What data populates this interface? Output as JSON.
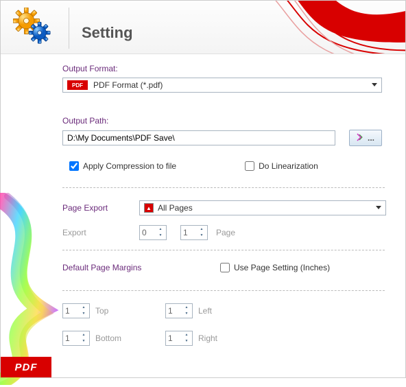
{
  "header": {
    "title": "Setting"
  },
  "output_format": {
    "label": "Output Format:",
    "chip": "PDF",
    "selected": "PDF Format (*.pdf)"
  },
  "output_path": {
    "label": "Output Path:",
    "value": "D:\\My Documents\\PDF Save\\",
    "browse": "..."
  },
  "checks": {
    "compression_label": "Apply Compression to file",
    "compression_checked": true,
    "linearization_label": "Do Linearization",
    "linearization_checked": false
  },
  "page_export": {
    "label": "Page Export",
    "chip": "▲",
    "selected": "All Pages"
  },
  "export_range": {
    "label": "Export",
    "from": "0",
    "to": "1",
    "suffix": "Page"
  },
  "margins": {
    "label": "Default Page Margins",
    "use_page_setting_label": "Use Page Setting (Inches)",
    "use_page_setting_checked": false,
    "top": {
      "value": "1",
      "label": "Top"
    },
    "bottom": {
      "value": "1",
      "label": "Bottom"
    },
    "left": {
      "value": "1",
      "label": "Left"
    },
    "right": {
      "value": "1",
      "label": "Right"
    }
  },
  "pdf_badge": "PDF"
}
